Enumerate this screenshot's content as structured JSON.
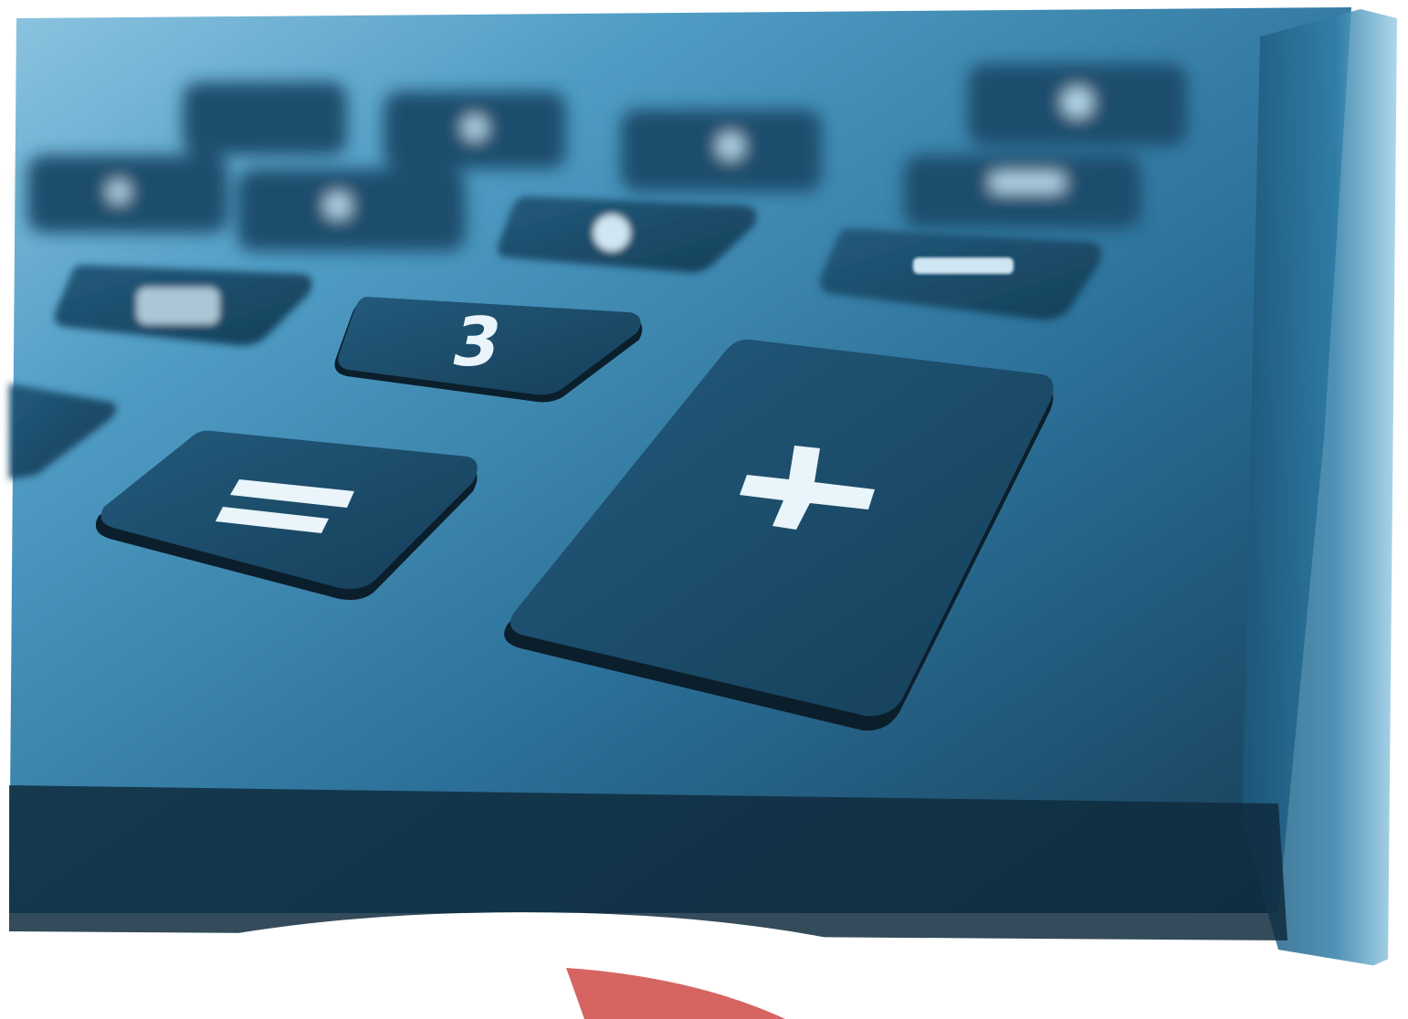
{
  "photo": {
    "keys": {
      "plus": "+",
      "equals": "=",
      "three": "3",
      "minus": "−"
    },
    "colors": {
      "surface_light": "#4f9cc4",
      "surface_mid": "#2a6f97",
      "surface_dark": "#163a52",
      "key_face": "#1d4d6b",
      "key_shadow": "#0b1e2b",
      "glyph": "#e9f4fb",
      "paper": "#ffffff",
      "red_accent": "#c8322e"
    }
  }
}
